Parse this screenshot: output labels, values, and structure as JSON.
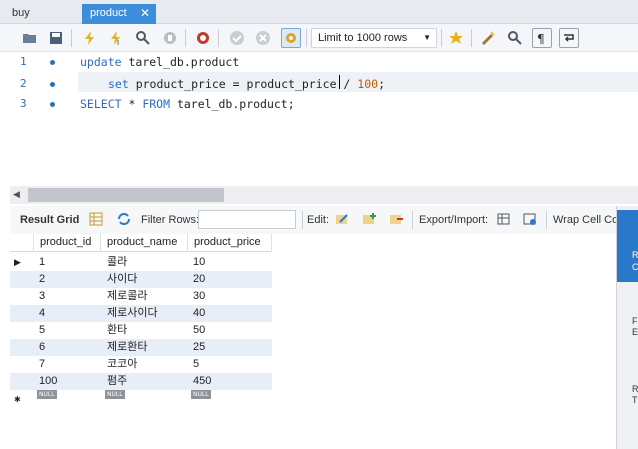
{
  "tabs": [
    {
      "label": "buy"
    },
    {
      "label": "product",
      "active": true
    }
  ],
  "tab_close_glyph": "✕",
  "toolbar": {
    "limit_label": "Limit to 1000 rows",
    "limit_arrow": "▼"
  },
  "editor": {
    "line_numbers": [
      "1",
      "2",
      "3"
    ],
    "line1": {
      "kw": "update",
      "rest": " tarel_db.product"
    },
    "line2": {
      "kw": "set",
      "rest1": " product_price = product_price",
      "op": " / ",
      "num": "100",
      "end": ";"
    },
    "line3": {
      "kw1": "SELECT",
      "mid": " * ",
      "kw2": "FROM",
      "rest": " tarel_db.product;"
    }
  },
  "scroll_left_arrow": "◀",
  "result_toolbar": {
    "result_grid": "Result Grid",
    "filter_rows": "Filter Rows:",
    "edit": "Edit:",
    "export_import": "Export/Import:",
    "wrap_cell": "Wrap Cell Con"
  },
  "grid": {
    "columns": [
      "product_id",
      "product_name",
      "product_price"
    ],
    "rows": [
      {
        "id": "1",
        "name": "콜라",
        "price": "10"
      },
      {
        "id": "2",
        "name": "사이다",
        "price": "20"
      },
      {
        "id": "3",
        "name": "제로콜라",
        "price": "30"
      },
      {
        "id": "4",
        "name": "제로사이다",
        "price": "40"
      },
      {
        "id": "5",
        "name": "환타",
        "price": "50"
      },
      {
        "id": "6",
        "name": "제로환타",
        "price": "25"
      },
      {
        "id": "7",
        "name": "코코아",
        "price": "5"
      },
      {
        "id": "100",
        "name": "펌주",
        "price": "450"
      }
    ],
    "null_label": "NULL",
    "current_row_marker": "▶",
    "new_row_marker": "✱"
  },
  "right_panel": {
    "labels": [
      "R",
      "C",
      "F",
      "E",
      "R",
      "T"
    ]
  },
  "colors": {
    "accent": "#3c8edb",
    "keyword": "#2e6bc6",
    "number": "#c05a00",
    "alt_row": "#e8eef8"
  }
}
